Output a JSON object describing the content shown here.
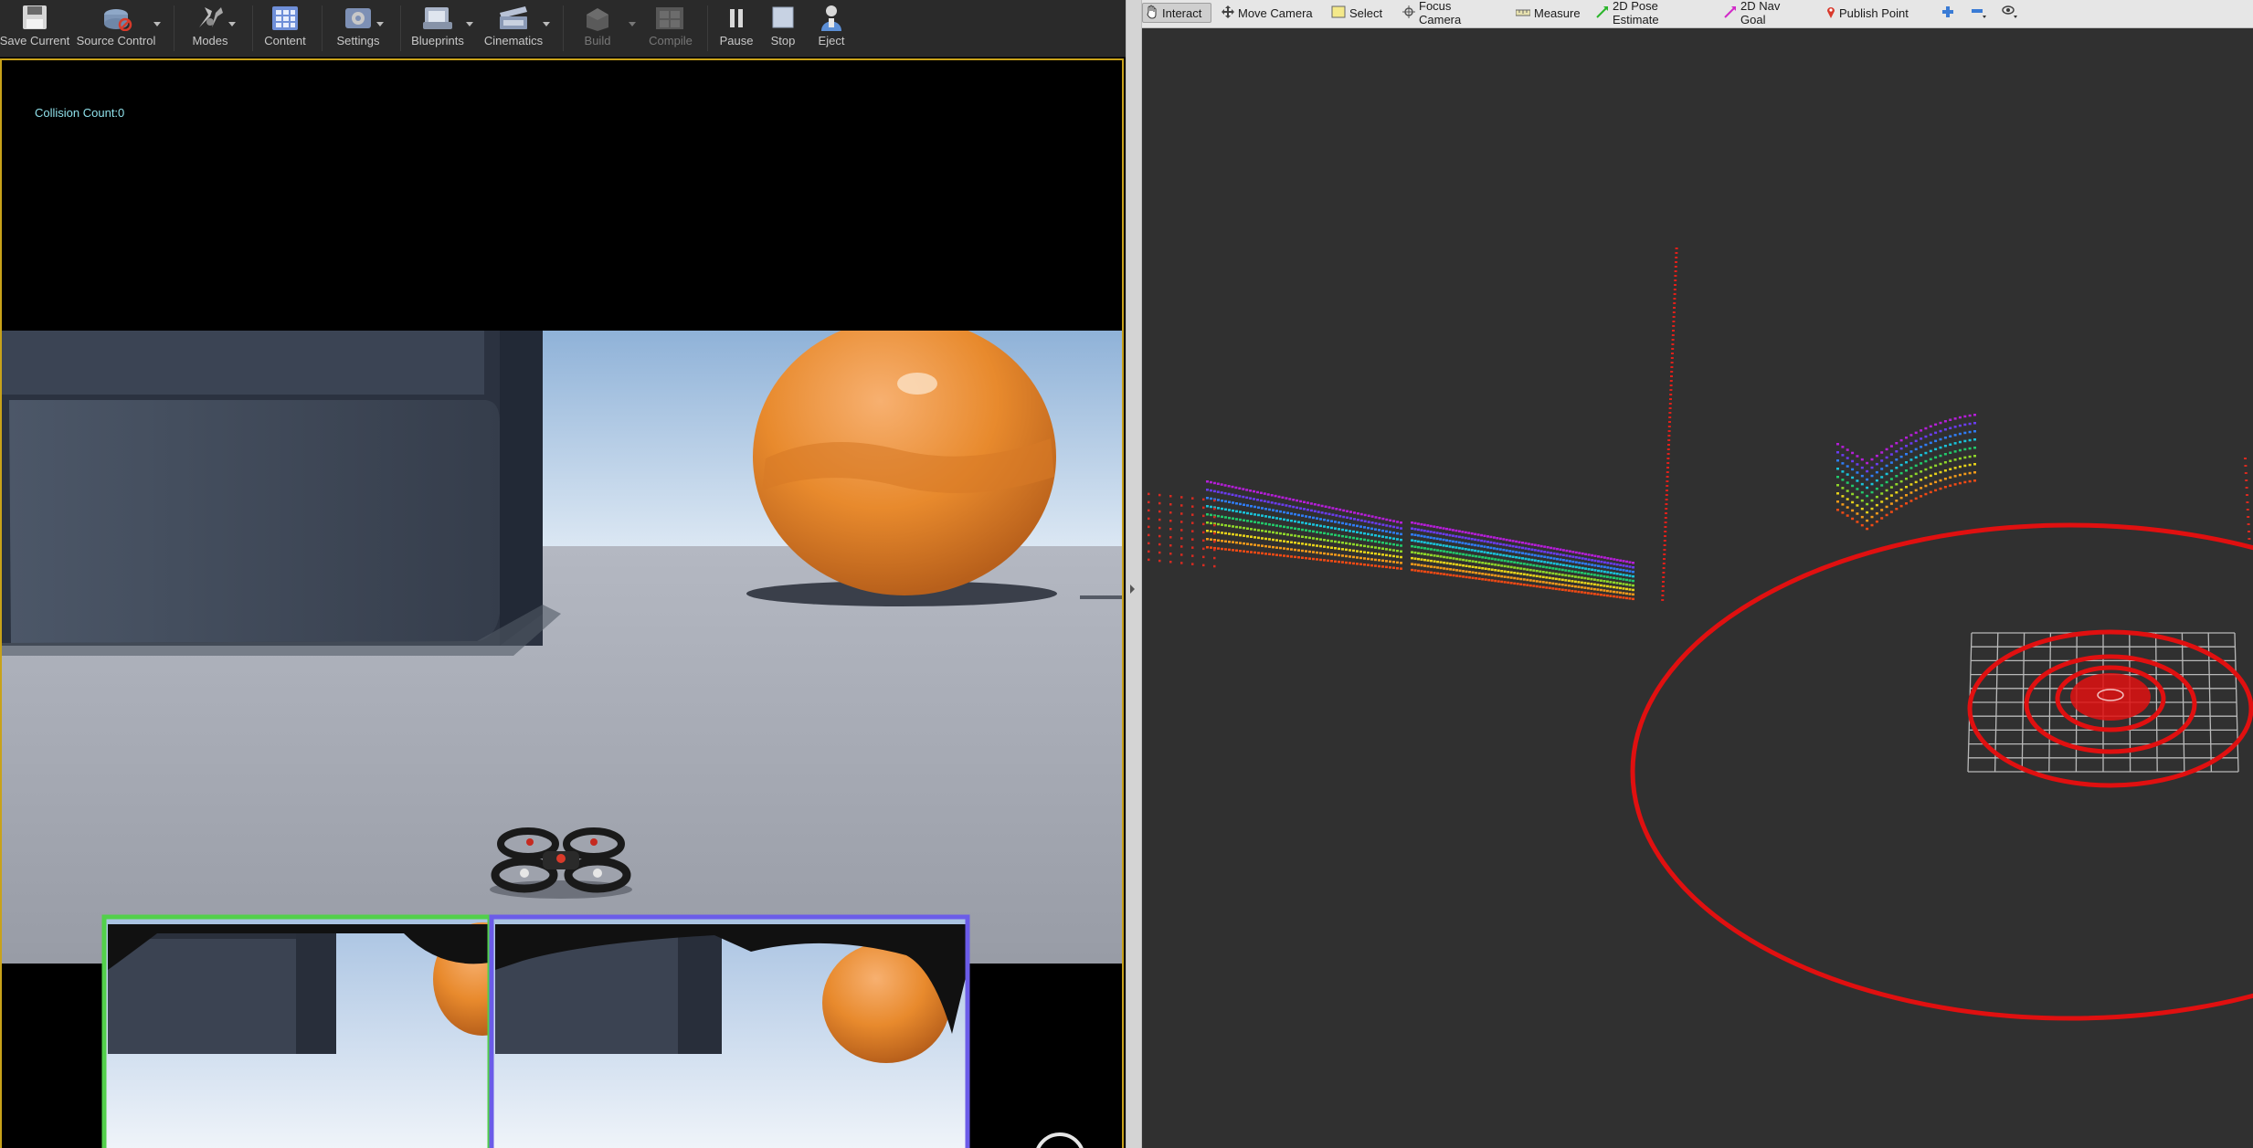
{
  "unreal": {
    "toolbar": {
      "save_current": "Save Current",
      "source_control": "Source Control",
      "modes": "Modes",
      "content": "Content",
      "settings": "Settings",
      "blueprints": "Blueprints",
      "cinematics": "Cinematics",
      "build": "Build",
      "compile": "Compile",
      "pause": "Pause",
      "stop": "Stop",
      "eject": "Eject"
    },
    "viewport": {
      "collision_count": "Collision Count:0"
    }
  },
  "rviz": {
    "tools": {
      "interact": "Interact",
      "move_camera": "Move Camera",
      "select": "Select",
      "focus_camera": "Focus Camera",
      "measure": "Measure",
      "pose_estimate": "2D Pose Estimate",
      "nav_goal": "2D Nav Goal",
      "publish_point": "Publish Point"
    },
    "active_tool": "Interact"
  },
  "colors": {
    "ue_toolbar": "#2a2a2a",
    "viewport_border": "#c8a21a",
    "collision_text": "#8fe0ea",
    "rviz_background": "#303030",
    "laser_ring": "#e01010",
    "left_subview_border": "#52d04a",
    "right_subview_border": "#6b5ce8"
  }
}
